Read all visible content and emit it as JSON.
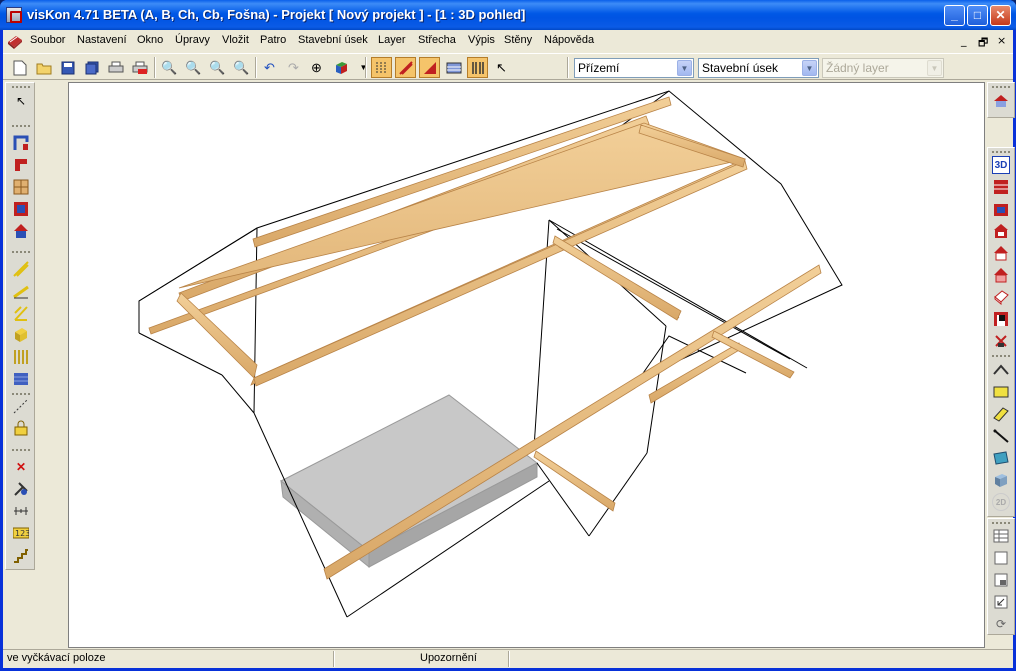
{
  "window": {
    "title": "visKon 4.71 BETA (A, B, Ch, Cb, Fošna) - Projekt [ Nový projekt ]  - [1 : 3D pohled]"
  },
  "menu": {
    "items": [
      "Soubor",
      "Nastavení",
      "Okno",
      "Úpravy",
      "Vložit",
      "Patro",
      "Stavební úsek",
      "Layer",
      "Střecha",
      "Výpis",
      "Stěny",
      "Nápověda"
    ],
    "mdi": {
      "minimize": "_",
      "restore": "🗗",
      "close": "×"
    }
  },
  "toolbar": {
    "icons": [
      "new-icon",
      "open-icon",
      "save-icon",
      "save-all-icon",
      "print-icon",
      "print-pdf-icon",
      "zoom-in-icon",
      "zoom-out-icon",
      "zoom-window-icon",
      "zoom-fit-icon",
      "undo-icon",
      "redo-icon",
      "crosshair-icon",
      "3d-box-icon",
      "beam-grid-icon",
      "rafter-icon",
      "roof-icon",
      "hatch-icon",
      "columns-icon",
      "pointer-icon"
    ],
    "floor_combo": "Přízemí",
    "section_combo": "Stavební úsek",
    "layer_combo": "Žádný layer"
  },
  "left_toolbar": {
    "icons": [
      "select-arrow-icon",
      "wall-corner-icon",
      "wall-l-icon",
      "window-icon",
      "door-icon",
      "house-icon",
      "beam-diagonal-icon",
      "rafter-icon",
      "truss-icon",
      "box-beam-icon",
      "columns-icon",
      "fill-icon",
      "dashed-line-icon",
      "lock-icon",
      "delete-x-icon",
      "tools-icon",
      "measure-icon",
      "numbering-icon",
      "stairs-icon"
    ]
  },
  "right_toolbar": {
    "icons": [
      "house-view-icon",
      "3d-view-icon",
      "floor-plan-icon",
      "roof-plan-icon",
      "section-icon",
      "house-red-icon",
      "house-outline-icon",
      "box-outline-icon",
      "elevation-icon",
      "tool-icon",
      "curve-icon",
      "rect-yellow-icon",
      "prism-icon",
      "line-icon",
      "panel-icon",
      "2d-icon",
      "table-icon",
      "blank-icon",
      "window-small-icon",
      "resize-icon",
      "refresh-icon"
    ],
    "label_3d": "3D",
    "label_2d": "2D"
  },
  "status": {
    "left": "ve vyčkávací poloze",
    "center": "Upozornění"
  },
  "colors": {
    "title_blue": "#0054e3",
    "beam": "#e8bc80",
    "beam_edge": "#c9955a",
    "slab": "#c8c8c8"
  }
}
